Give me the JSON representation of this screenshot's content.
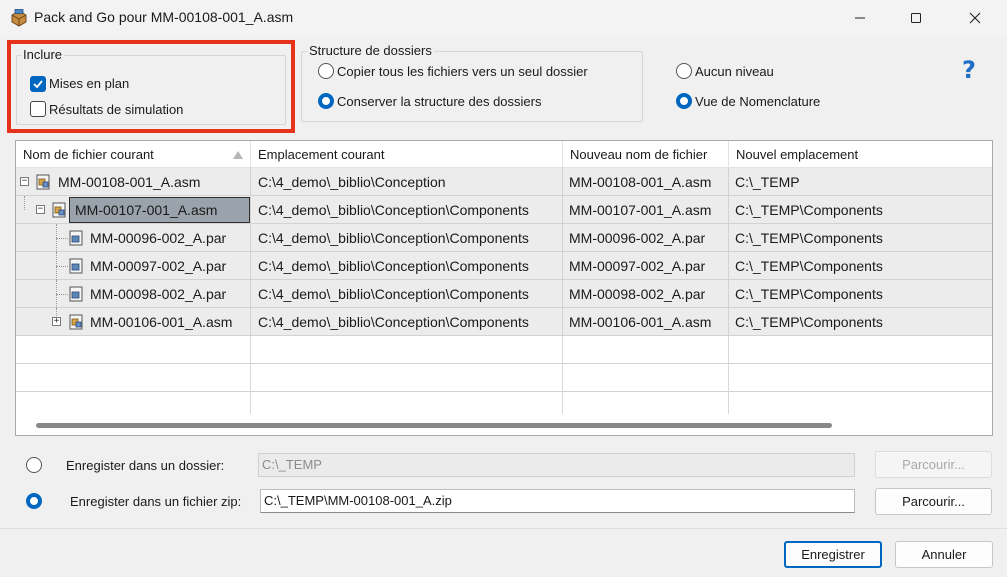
{
  "window": {
    "title": "Pack and Go pour MM-00108-001_A.asm",
    "icons": {
      "app": "pack-and-go-icon",
      "minimize": "minimize-icon",
      "maximize": "maximize-icon",
      "close": "close-icon"
    }
  },
  "include": {
    "label": "Inclure",
    "options": [
      {
        "label": "Mises en plan",
        "checked": true
      },
      {
        "label": "Résultats de simulation",
        "checked": false
      }
    ]
  },
  "folder_structure": {
    "label": "Structure de dossiers",
    "options": [
      {
        "label": "Copier tous les fichiers vers un seul dossier",
        "selected": false
      },
      {
        "label": "Conserver la structure des dossiers",
        "selected": true
      }
    ],
    "level_options": [
      {
        "label": "Aucun niveau",
        "selected": false
      },
      {
        "label": "Vue de Nomenclature",
        "selected": true
      }
    ]
  },
  "help": {
    "glyph": "?",
    "icon": "help-icon"
  },
  "table": {
    "columns": [
      "Nom de fichier courant",
      "Emplacement courant",
      "Nouveau nom de fichier",
      "Nouvel emplacement"
    ],
    "rows": [
      {
        "name": "MM-00108-001_A.asm",
        "location": "C:\\4_demo\\_biblio\\Conception",
        "new_name": "MM-00108-001_A.asm",
        "new_location": "C:\\_TEMP",
        "type": "asm",
        "expander": "−",
        "selected": false
      },
      {
        "name": "MM-00107-001_A.asm",
        "location": "C:\\4_demo\\_biblio\\Conception\\Components",
        "new_name": "MM-00107-001_A.asm",
        "new_location": "C:\\_TEMP\\Components",
        "type": "asm",
        "expander": "−",
        "selected": true
      },
      {
        "name": "MM-00096-002_A.par",
        "location": "C:\\4_demo\\_biblio\\Conception\\Components",
        "new_name": "MM-00096-002_A.par",
        "new_location": "C:\\_TEMP\\Components",
        "type": "par",
        "expander": "",
        "selected": false
      },
      {
        "name": "MM-00097-002_A.par",
        "location": "C:\\4_demo\\_biblio\\Conception\\Components",
        "new_name": "MM-00097-002_A.par",
        "new_location": "C:\\_TEMP\\Components",
        "type": "par",
        "expander": "",
        "selected": false
      },
      {
        "name": "MM-00098-002_A.par",
        "location": "C:\\4_demo\\_biblio\\Conception\\Components",
        "new_name": "MM-00098-002_A.par",
        "new_location": "C:\\_TEMP\\Components",
        "type": "par",
        "expander": "",
        "selected": false
      },
      {
        "name": "MM-00106-001_A.asm",
        "location": "C:\\4_demo\\_biblio\\Conception\\Components",
        "new_name": "MM-00106-001_A.asm",
        "new_location": "C:\\_TEMP\\Components",
        "type": "asm",
        "expander": "+",
        "selected": false
      }
    ]
  },
  "save": {
    "folder": {
      "label": "Enregister dans un dossier:",
      "value": "C:\\_TEMP",
      "browse": "Parcourir...",
      "selected": false
    },
    "zip": {
      "label": "Enregister dans un fichier zip:",
      "value": "C:\\_TEMP\\MM-00108-001_A.zip",
      "browse": "Parcourir...",
      "selected": true
    }
  },
  "footer": {
    "save_button": "Enregistrer",
    "cancel_button": "Annuler"
  },
  "colors": {
    "accent": "#0067c0",
    "highlight": "#e8331c",
    "selection": "#9aa3ab",
    "row_fill": "#ececec"
  }
}
